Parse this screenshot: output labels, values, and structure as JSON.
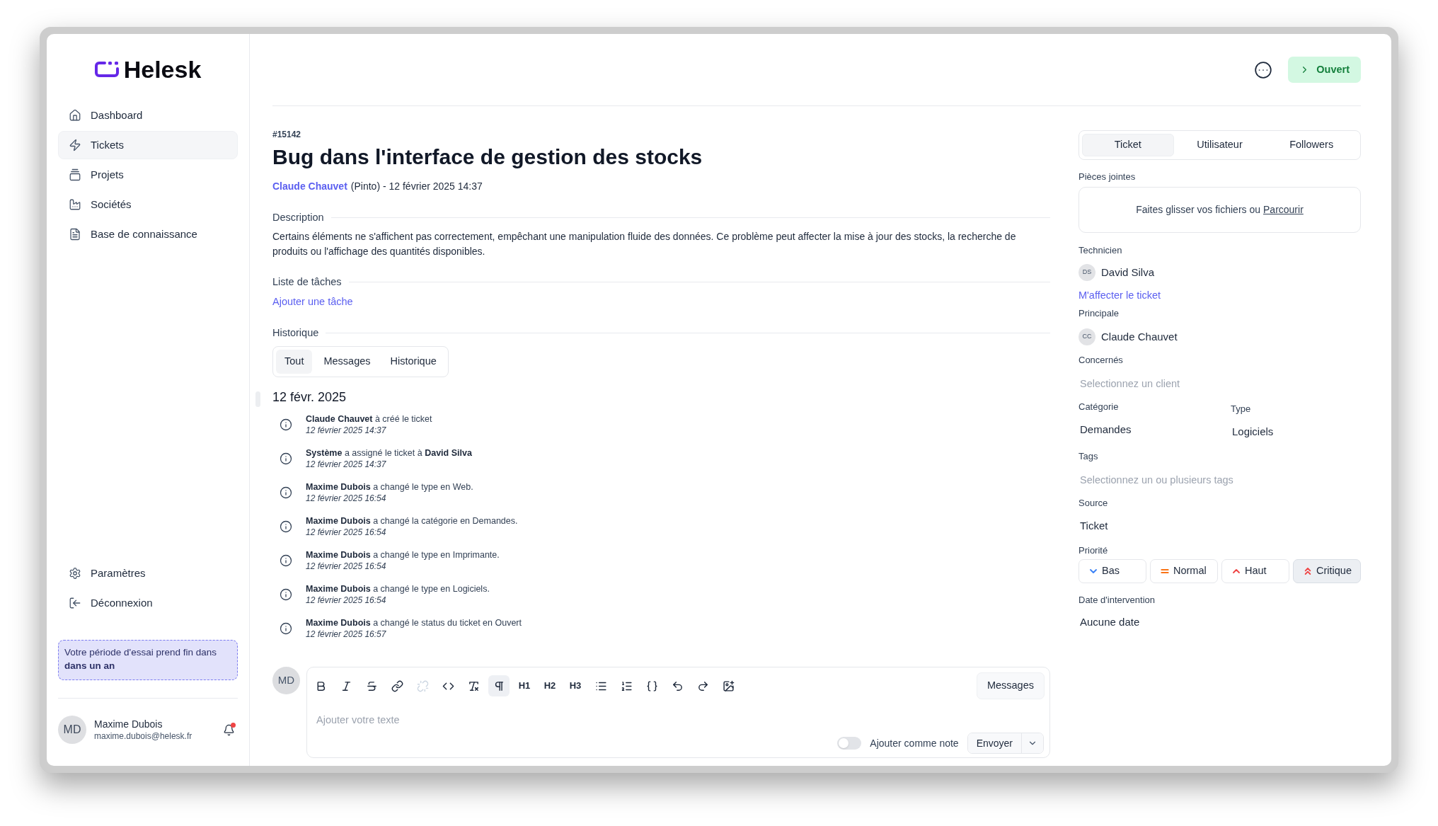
{
  "app": {
    "logo": "Helesk"
  },
  "sidebar": {
    "items": [
      {
        "label": "Dashboard",
        "selected": false
      },
      {
        "label": "Tickets",
        "selected": true
      },
      {
        "label": "Projets",
        "selected": false
      },
      {
        "label": "Sociétés",
        "selected": false
      },
      {
        "label": "Base de connaissance",
        "selected": false
      }
    ],
    "bottom_items": [
      {
        "label": "Paramètres",
        "selected": false
      },
      {
        "label": "Déconnexion",
        "selected": false
      }
    ],
    "trial_notice": "Votre période d'essai prend fin dans **dans un an**",
    "user": {
      "initials": "MD",
      "name": "Maxime Dubois",
      "email": "maxime.dubois@helesk.fr",
      "notification": true
    }
  },
  "header": {
    "status_button": "Ouvert"
  },
  "ticket": {
    "number": "#15142",
    "title": "Bug dans l'interface de gestion des stocks",
    "author": "Claude Chauvet",
    "meta": "(Pinto) - 12 février 2025 14:37",
    "description": {
      "heading": "Description",
      "text": "Certains éléments ne s'affichent pas correctement, empêchant une manipulation fluide des données. Ce problème peut affecter la mise à jour des stocks, la recherche de produits ou l'affichage des quantités disponibles."
    },
    "tasks": {
      "heading": "Liste de tâches",
      "add_link": "Ajouter une tâche"
    },
    "history": {
      "heading": "Historique",
      "tabs": [
        {
          "label": "Tout",
          "selected": true
        },
        {
          "label": "Messages",
          "selected": false
        },
        {
          "label": "Historique",
          "selected": false
        }
      ],
      "groups": [
        {
          "date": "12 févr. 2025",
          "entries": [
            {
              "text": "**Claude Chauvet** à créé le ticket",
              "time": "12 février 2025 14:37"
            },
            {
              "text": "**Système** a assigné le ticket à **David Silva**",
              "time": "12 février 2025 14:37"
            },
            {
              "text": "**Maxime Dubois** a changé le type en Web.",
              "time": "12 février 2025 16:54"
            },
            {
              "text": "**Maxime Dubois** a changé la catégorie en Demandes.",
              "time": "12 février 2025 16:54"
            },
            {
              "text": "**Maxime Dubois** a changé le type en Imprimante.",
              "time": "12 février 2025 16:54"
            },
            {
              "text": "**Maxime Dubois** a changé le type en Logiciels.",
              "time": "12 février 2025 16:54"
            },
            {
              "text": "**Maxime Dubois** a changé le status du ticket en Ouvert",
              "time": "12 février 2025 16:57"
            }
          ]
        }
      ]
    }
  },
  "editor": {
    "avatar": "MD",
    "toolbar": [
      {
        "kind": "icon",
        "active": false,
        "disabled": false
      },
      {
        "kind": "icon",
        "active": false,
        "disabled": false
      },
      {
        "kind": "icon",
        "active": false,
        "disabled": false
      },
      {
        "kind": "icon",
        "active": false,
        "disabled": false
      },
      {
        "kind": "icon",
        "active": false,
        "disabled": true
      },
      {
        "kind": "icon",
        "active": false,
        "disabled": false
      },
      {
        "kind": "icon",
        "active": false,
        "disabled": false
      },
      {
        "kind": "icon",
        "active": true,
        "disabled": false
      },
      {
        "kind": "text",
        "label": "H1",
        "active": false,
        "disabled": false
      },
      {
        "kind": "text",
        "label": "H2",
        "active": false,
        "disabled": false
      },
      {
        "kind": "text",
        "label": "H3",
        "active": false,
        "disabled": false
      },
      {
        "kind": "icon",
        "active": false,
        "disabled": false
      },
      {
        "kind": "icon",
        "active": false,
        "disabled": false
      },
      {
        "kind": "icon",
        "active": false,
        "disabled": false
      },
      {
        "kind": "icon",
        "active": false,
        "disabled": false
      },
      {
        "kind": "icon",
        "active": false,
        "disabled": false
      },
      {
        "kind": "icon",
        "active": false,
        "disabled": false
      }
    ],
    "messages_button": "Messages",
    "placeholder": "Ajouter votre texte",
    "note_toggle": {
      "label": "Ajouter comme note",
      "on": false
    },
    "send_button": "Envoyer"
  },
  "details": {
    "tabs": [
      {
        "label": "Ticket",
        "selected": true
      },
      {
        "label": "Utilisateur",
        "selected": false
      },
      {
        "label": "Followers",
        "selected": false
      }
    ],
    "attachments": {
      "label": "Pièces jointes",
      "hint": "Faites glisser vos fichiers ou",
      "browse_link": "Parcourir"
    },
    "technician": {
      "label": "Technicien",
      "initials": "DS",
      "name": "David Silva",
      "assign_link": "M'affecter le ticket"
    },
    "principal": {
      "label": "Principale",
      "initials": "CC",
      "name": "Claude Chauvet"
    },
    "concerned": {
      "label": "Concernés",
      "placeholder": "Selectionnez un client"
    },
    "category": {
      "label": "Catégorie",
      "value": "Demandes"
    },
    "type": {
      "label": "Type",
      "value": "Logiciels"
    },
    "tags": {
      "label": "Tags",
      "placeholder": "Selectionnez un ou plusieurs tags"
    },
    "source": {
      "label": "Source",
      "value": "Ticket"
    },
    "priority": {
      "label": "Priorité",
      "options": [
        {
          "label": "Bas",
          "color": "#3b82f6",
          "selected": false
        },
        {
          "label": "Normal",
          "color": "#f97316",
          "selected": false
        },
        {
          "label": "Haut",
          "color": "#ef4444",
          "selected": false
        },
        {
          "label": "Critique",
          "color": "#ef4444",
          "selected": true
        }
      ]
    },
    "intervention_date": {
      "label": "Date d'intervention",
      "value": "Aucune date"
    }
  }
}
